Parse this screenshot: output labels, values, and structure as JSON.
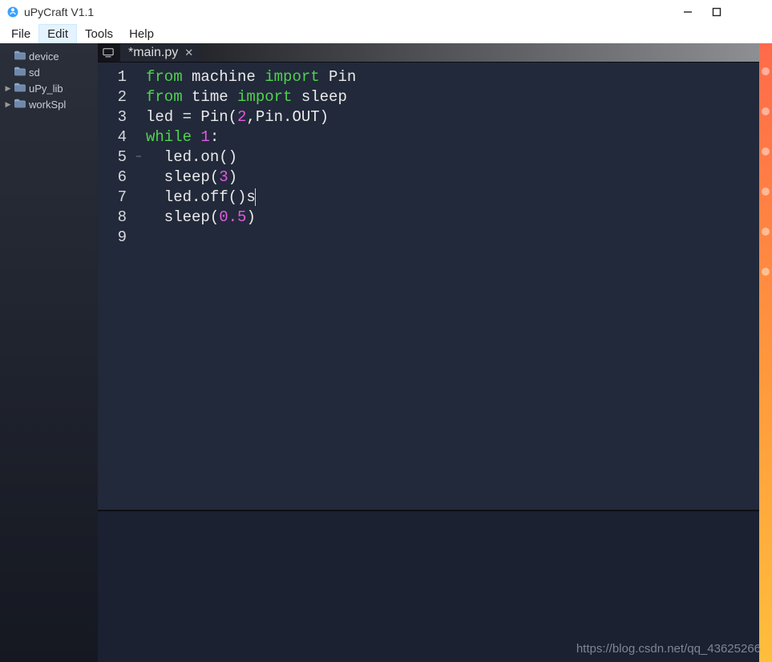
{
  "window": {
    "title": "uPyCraft V1.1"
  },
  "menu": {
    "file": "File",
    "edit": "Edit",
    "tools": "Tools",
    "help": "Help"
  },
  "sidebar": {
    "items": [
      {
        "label": "device",
        "expandable": false
      },
      {
        "label": "sd",
        "expandable": false
      },
      {
        "label": "uPy_lib",
        "expandable": true
      },
      {
        "label": "workSpl",
        "expandable": true
      }
    ]
  },
  "tabs": {
    "active": {
      "label": "*main.py"
    }
  },
  "code": {
    "lines": [
      {
        "n": "1",
        "tokens": [
          [
            "kw",
            "from"
          ],
          [
            "txt",
            " machine "
          ],
          [
            "kw",
            "import"
          ],
          [
            "txt",
            " Pin"
          ]
        ]
      },
      {
        "n": "2",
        "tokens": [
          [
            "kw",
            "from"
          ],
          [
            "txt",
            " time "
          ],
          [
            "kw",
            "import"
          ],
          [
            "txt",
            " sleep"
          ]
        ]
      },
      {
        "n": "3",
        "tokens": [
          [
            "txt",
            "led = Pin("
          ],
          [
            "num",
            "2"
          ],
          [
            "txt",
            ",Pin.OUT)"
          ]
        ]
      },
      {
        "n": "4",
        "tokens": [
          [
            "txt",
            ""
          ]
        ]
      },
      {
        "n": "5",
        "fold": true,
        "tokens": [
          [
            "kw",
            "while"
          ],
          [
            "txt",
            " "
          ],
          [
            "num",
            "1"
          ],
          [
            "txt",
            ":"
          ]
        ]
      },
      {
        "n": "6",
        "tokens": [
          [
            "txt",
            "  led.on()"
          ]
        ]
      },
      {
        "n": "7",
        "tokens": [
          [
            "txt",
            "  sleep("
          ],
          [
            "num",
            "3"
          ],
          [
            "txt",
            ")"
          ]
        ]
      },
      {
        "n": "8",
        "tokens": [
          [
            "txt",
            "  led.off()s"
          ]
        ],
        "cursor": true
      },
      {
        "n": "9",
        "tokens": [
          [
            "txt",
            "  sleep("
          ],
          [
            "num",
            "0.5"
          ],
          [
            "txt",
            ")"
          ]
        ]
      }
    ]
  },
  "watermark": "https://blog.csdn.net/qq_43625266"
}
